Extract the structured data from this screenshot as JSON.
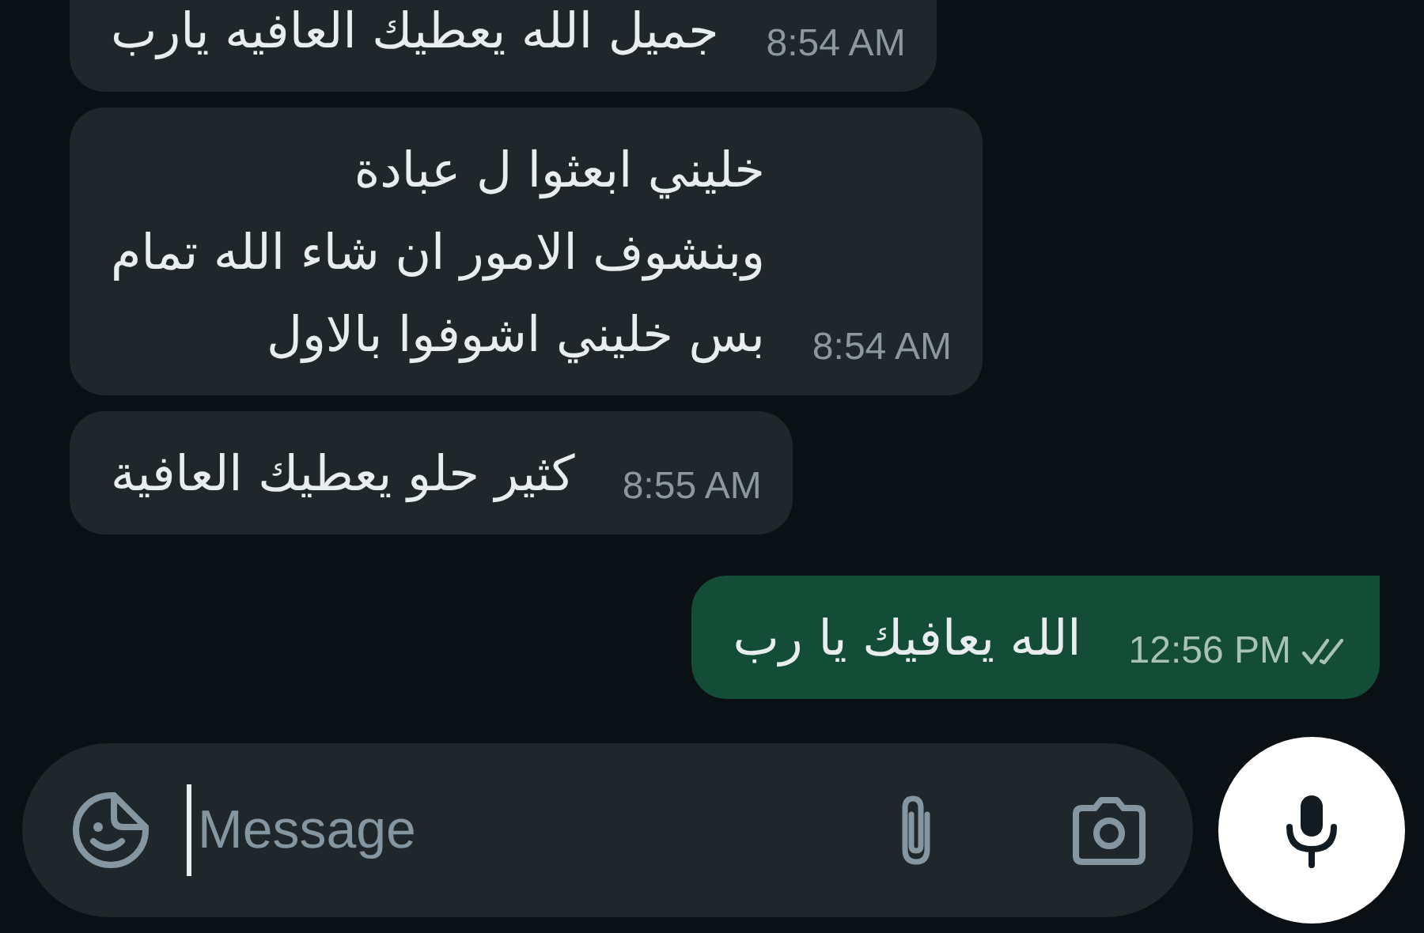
{
  "messages": [
    {
      "kind": "incoming",
      "lines": [
        "جميل الله يعطيك العافيه يارب"
      ],
      "time": "8:54 AM"
    },
    {
      "kind": "incoming",
      "lines": [
        "خليني ابعثوا ل عبادة",
        "وبنشوف الامور ان شاء الله تمام",
        "بس خليني اشوفوا بالاول"
      ],
      "time": "8:54 AM"
    },
    {
      "kind": "incoming",
      "lines": [
        "كثير حلو يعطيك العافية"
      ],
      "time": "8:55 AM"
    },
    {
      "kind": "outgoing",
      "lines": [
        "الله يعافيك يا رب"
      ],
      "time": "12:56 PM",
      "read": false
    }
  ],
  "composer": {
    "placeholder": "Message"
  }
}
